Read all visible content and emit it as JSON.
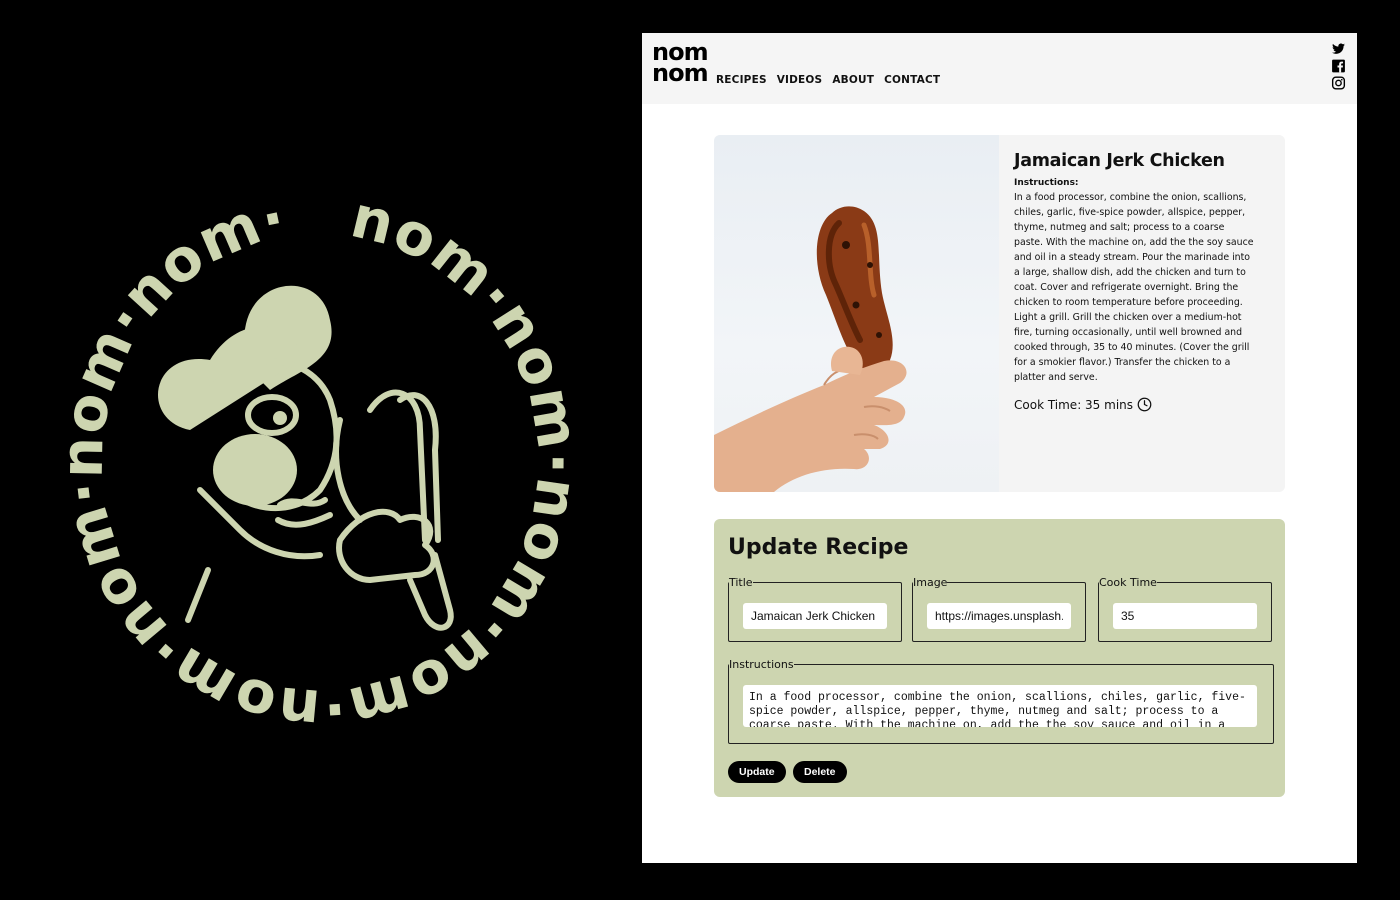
{
  "emblem": {
    "ring_text": "nom·nom·nom·nom·nom·nom·nom·nom·",
    "color": "#cdd5b0"
  },
  "site": {
    "logo_top": "nom",
    "logo_bottom": "nom",
    "nav": [
      "RECIPES",
      "VIDEOS",
      "ABOUT",
      "CONTACT"
    ],
    "social_icons": [
      "twitter-icon",
      "facebook-icon",
      "instagram-icon"
    ]
  },
  "recipe": {
    "title": "Jamaican Jerk Chicken",
    "instructions_label": "Instructions:",
    "instructions_lines": [
      "In a food processor, combine the onion, scallions,",
      "chiles, garlic, five-spice powder, allspice, pepper,",
      "thyme, nutmeg and salt; process to a coarse",
      "paste. With the machine on, add the the soy sauce",
      "and oil in a steady stream. Pour the marinade into",
      "a large, shallow dish, add the chicken and turn to",
      "coat. Cover and refrigerate overnight. Bring the",
      "chicken to room temperature before proceeding.",
      "Light a grill. Grill the chicken over a medium-hot",
      "fire, turning occasionally, until well browned and",
      "cooked through, 35 to 40 minutes. (Cover the grill",
      "for a smokier flavor.) Transfer the chicken to a",
      "platter and serve."
    ],
    "cook_time": "Cook Time: 35 mins"
  },
  "form": {
    "heading": "Update Recipe",
    "title_legend": "Title",
    "title_value": "Jamaican Jerk Chicken",
    "image_legend": "Image",
    "image_value": "https://images.unsplash.c",
    "cook_legend": "Cook Time",
    "cook_value": "35",
    "instructions_legend": "Instructions",
    "instructions_value": "In a food processor, combine the onion, scallions, chiles, garlic, five-spice powder, allspice, pepper, thyme, nutmeg and salt; process to a coarse paste. With the machine on, add the the soy sauce and oil in a",
    "update_label": "Update",
    "delete_label": "Delete"
  },
  "colors": {
    "page_bg": "#000000",
    "accent_green": "#cdd5b0",
    "header_bg": "#f5f5f5",
    "card_bg": "#f4f4f4",
    "button_bg": "#000000"
  }
}
